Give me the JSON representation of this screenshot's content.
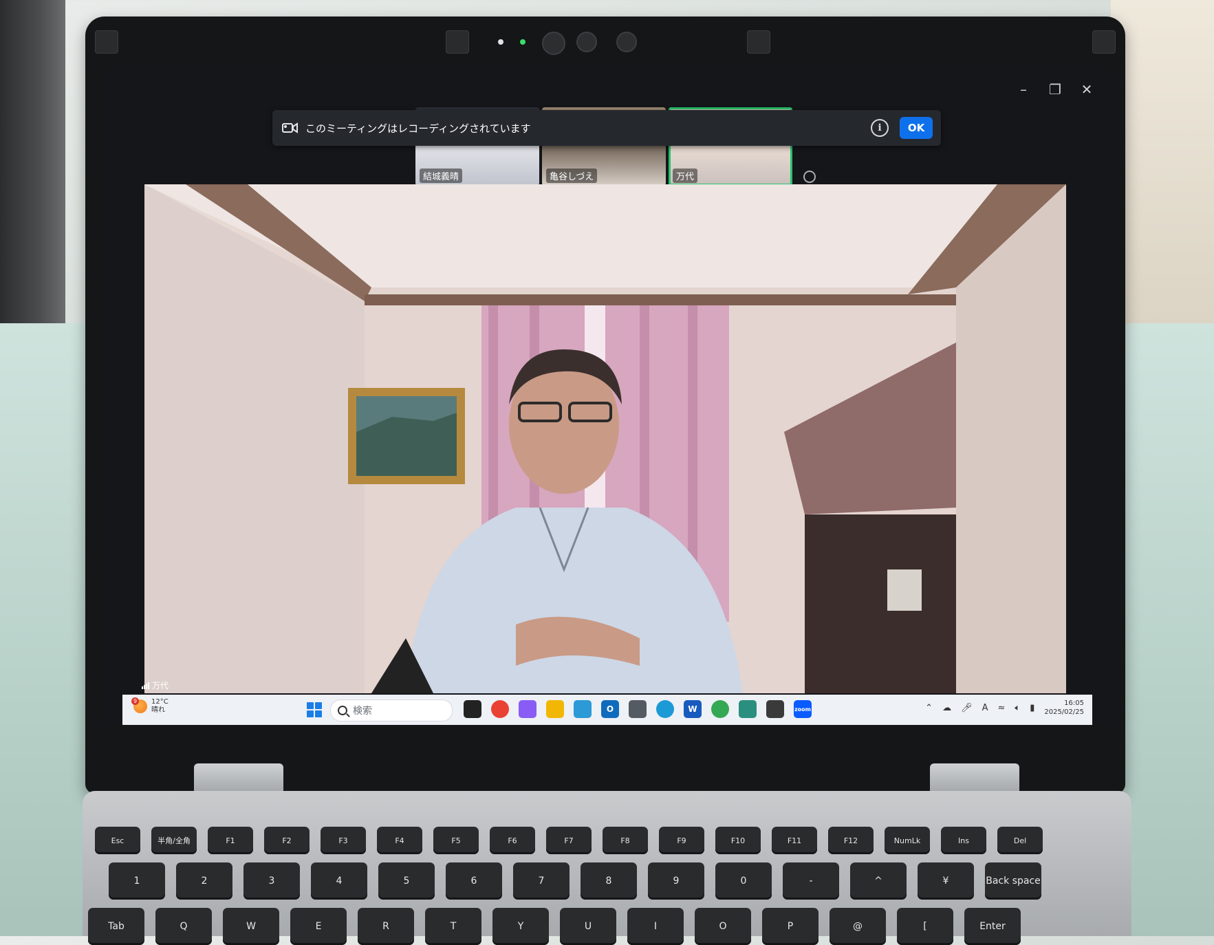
{
  "meeting": {
    "banner_message": "このミーティングはレコーディングされています",
    "banner_ok": "OK",
    "participants": [
      {
        "name": "結城義晴"
      },
      {
        "name": "亀谷しづえ"
      },
      {
        "name": "万代",
        "active": true
      }
    ],
    "active_speaker_label": "万代"
  },
  "window_controls": {
    "minimize_icon": "minimize-icon",
    "restore_icon": "restore-icon",
    "close_icon": "close-icon"
  },
  "taskbar": {
    "weather": {
      "temperature": "12°C",
      "condition": "晴れ",
      "notification_count": "9"
    },
    "search_placeholder": "検索",
    "apps": [
      {
        "name": "task-view",
        "color": "#222222"
      },
      {
        "name": "chrome",
        "color": "#e94235"
      },
      {
        "name": "copilot",
        "color": "#8a5cf6"
      },
      {
        "name": "file-explorer",
        "color": "#f2b705"
      },
      {
        "name": "store",
        "color": "#2b9ad6"
      },
      {
        "name": "outlook",
        "color": "#0f6cbd"
      },
      {
        "name": "calculator",
        "color": "#555b63"
      },
      {
        "name": "edge",
        "color": "#1c9ad6"
      },
      {
        "name": "word",
        "color": "#185abd"
      },
      {
        "name": "chrome-alt",
        "color": "#34a853"
      },
      {
        "name": "notepad",
        "color": "#2a8f7e"
      },
      {
        "name": "app-figure",
        "color": "#3a3a3a"
      },
      {
        "name": "zoom",
        "color": "#0b5cff"
      }
    ],
    "tray_icons": [
      "chevron-up-icon",
      "onedrive-icon",
      "mic-icon",
      "ime-icon",
      "wifi-icon",
      "volume-icon",
      "battery-icon"
    ],
    "ime_label": "A",
    "time": "16:05",
    "date": "2025/02/25"
  },
  "keyboard": {
    "row1": [
      "Esc",
      "半角/全角",
      "F1",
      "F2",
      "F3",
      "F4",
      "F5",
      "F6",
      "F7",
      "F8",
      "F9",
      "F10",
      "F11",
      "F12",
      "NumLk",
      "Ins",
      "Del"
    ],
    "row2": [
      "1",
      "2",
      "3",
      "4",
      "5",
      "6",
      "7",
      "8",
      "9",
      "0",
      "-",
      "^",
      "¥",
      "Back space"
    ],
    "row3": [
      "Tab",
      "Q",
      "W",
      "E",
      "R",
      "T",
      "Y",
      "U",
      "I",
      "O",
      "P",
      "@",
      "[",
      "Enter"
    ]
  }
}
